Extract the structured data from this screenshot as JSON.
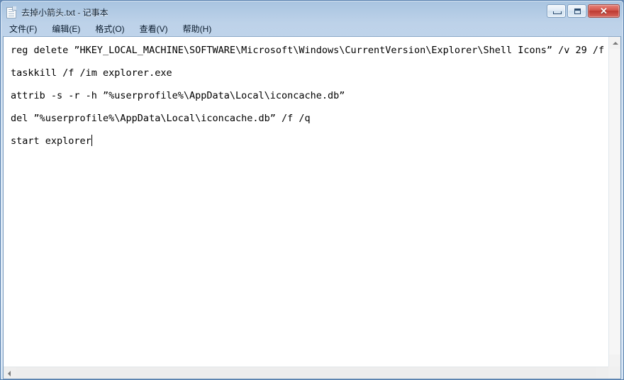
{
  "window": {
    "title": "去掉小箭头.txt - 记事本",
    "icon": "notepad-document-icon",
    "buttons": {
      "minimize_label": "—",
      "maximize_label": "□",
      "close_label": "✕"
    }
  },
  "menubar": {
    "items": [
      {
        "label": "文件(F)",
        "name": "menu-file"
      },
      {
        "label": "编辑(E)",
        "name": "menu-edit"
      },
      {
        "label": "格式(O)",
        "name": "menu-format"
      },
      {
        "label": "查看(V)",
        "name": "menu-view"
      },
      {
        "label": "帮助(H)",
        "name": "menu-help"
      }
    ]
  },
  "editor": {
    "lines": [
      "reg delete ”HKEY_LOCAL_MACHINE\\SOFTWARE\\Microsoft\\Windows\\CurrentVersion\\Explorer\\Shell Icons” /v 29 /f",
      "taskkill /f /im explorer.exe",
      "attrib -s -r -h ”%userprofile%\\AppData\\Local\\iconcache.db”",
      "del ”%userprofile%\\AppData\\Local\\iconcache.db” /f /q",
      "start explorer"
    ],
    "caret_line_index": 4
  },
  "scrollbars": {
    "vertical": {
      "up_arrow": "scroll-up-arrow-icon"
    },
    "horizontal": {
      "left_arrow": "scroll-left-arrow-icon"
    }
  },
  "colors": {
    "titlebar_accent": "#bdd2e9",
    "close_button": "#bc3a31",
    "frame_border": "#4f7aab",
    "client_background": "#ffffff"
  }
}
